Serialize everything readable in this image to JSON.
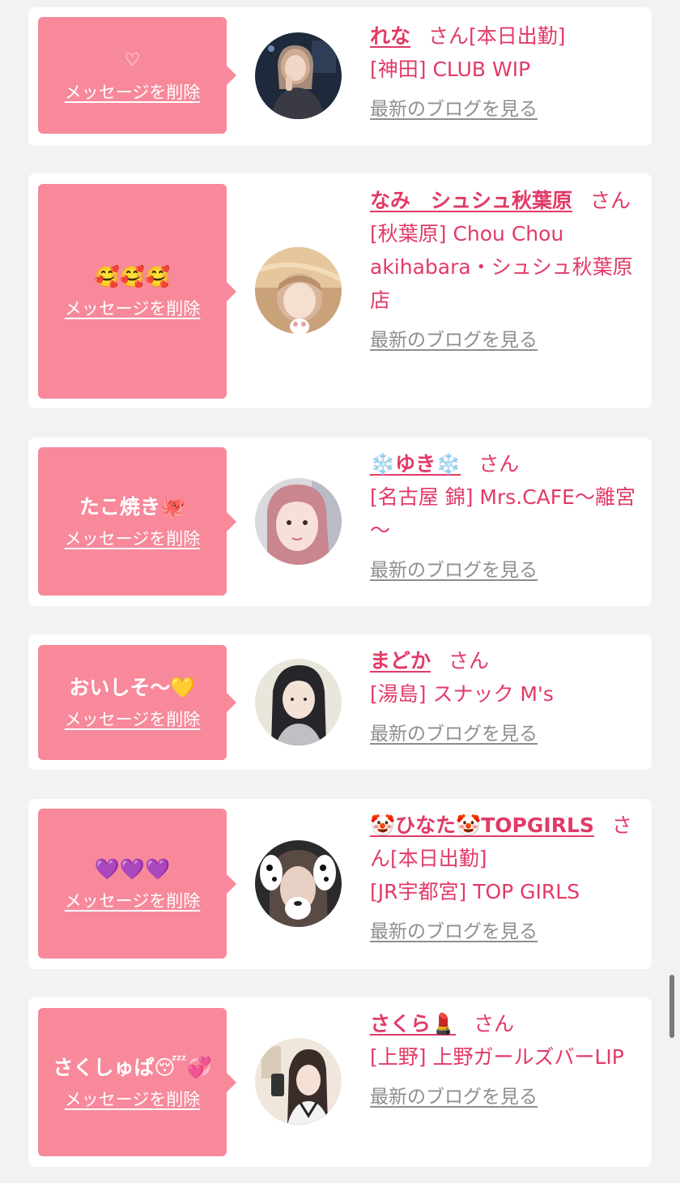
{
  "common": {
    "delete_label": "メッセージを削除",
    "blog_label": "最新のブログを見る",
    "san": "さん"
  },
  "colors": {
    "bubble": "#f7899b",
    "name": "#e23a66",
    "link_gray": "#8e8e8e",
    "background": "#f2f2f2"
  },
  "cards": [
    {
      "message": "♡",
      "name": "れな",
      "status": "[本日出勤]",
      "shop": "[神田] CLUB WIP"
    },
    {
      "message": "🥰🥰🥰",
      "name": "なみ　シュシュ秋葉原",
      "status": "",
      "shop": "[秋葉原] Chou Chou akihabara・シュシュ秋葉原店"
    },
    {
      "message": "たこ焼き🐙",
      "name": "❄️ゆき❄️",
      "status": "",
      "shop": "[名古屋 錦] Mrs.CAFE～離宮～"
    },
    {
      "message": "おいしそ〜💛",
      "name": "まどか",
      "status": "",
      "shop": "[湯島] スナック M's"
    },
    {
      "message": "💜💜💜",
      "name": "🤡ひなた🤡TOPGIRLS",
      "status": "[本日出勤]",
      "shop": "[JR宇都宮] TOP GIRLS"
    },
    {
      "message": "さくしゅぱ😴💞",
      "name": "さくら💄",
      "status": "",
      "shop": "[上野] 上野ガールズバーLIP"
    }
  ]
}
